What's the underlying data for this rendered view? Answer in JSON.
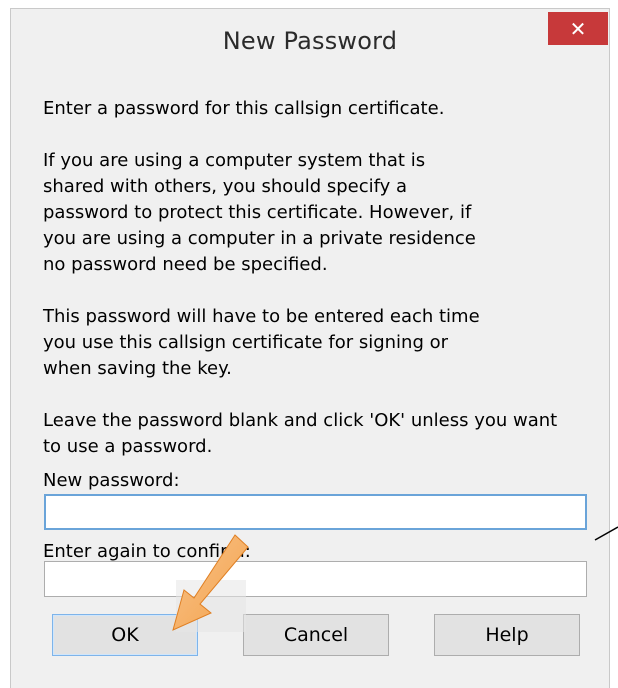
{
  "dialog": {
    "title": "New Password",
    "close_glyph": "✕",
    "instructions": [
      [
        "Enter a password for this callsign certificate."
      ],
      [
        "If you are using a computer system that is",
        "shared with others, you should specify a",
        "password to protect this certificate. However, if",
        "you are using a computer in a private residence",
        "no password need be specified."
      ],
      [
        "This password will have to be entered each time",
        "you use this callsign certificate for signing or",
        "when saving the key."
      ],
      [
        "Leave the password blank and click 'OK' unless you want",
        "to use a password."
      ]
    ],
    "new_password": {
      "label": "New password:",
      "value": ""
    },
    "confirm_password": {
      "label": "Enter again to confirm:",
      "value": ""
    },
    "buttons": {
      "ok": "OK",
      "cancel": "Cancel",
      "help": "Help"
    }
  },
  "annotations": {
    "arrow_color": "#f4a24c",
    "arrow_target": "ok-button"
  }
}
